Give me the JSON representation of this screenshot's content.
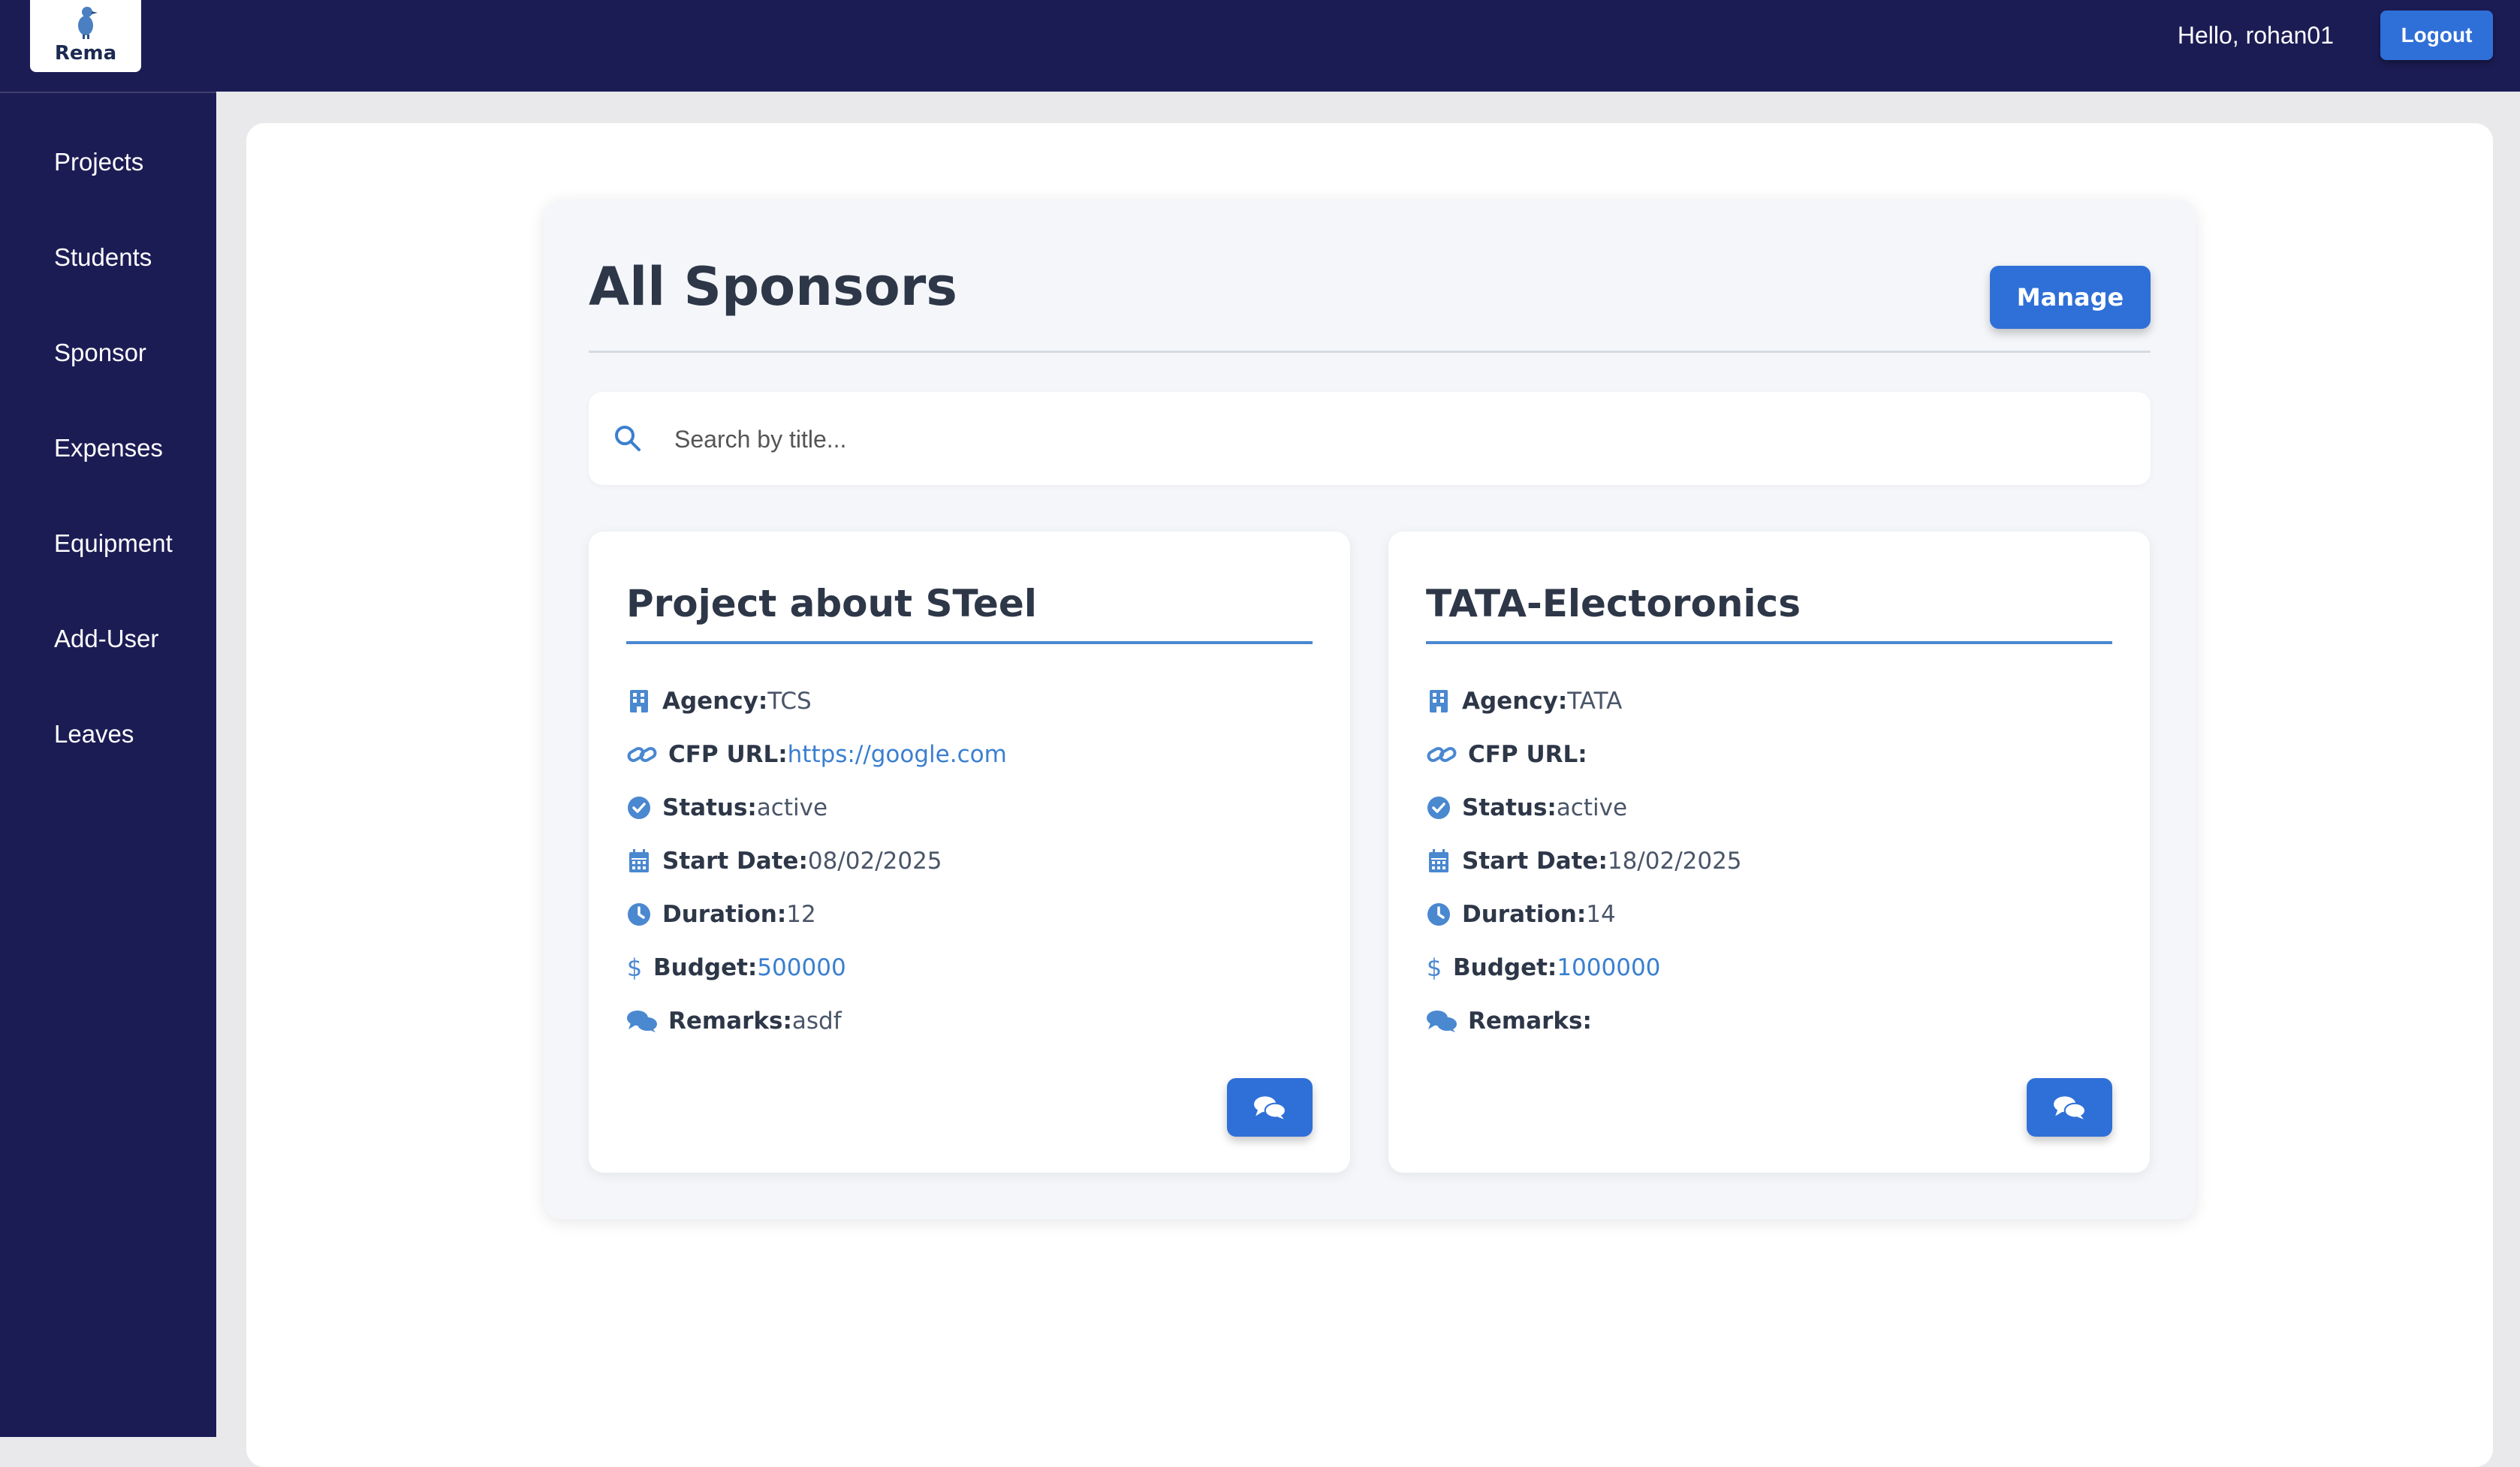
{
  "app": {
    "logo_text": "Rema",
    "greeting": "Hello, rohan01",
    "logout_label": "Logout"
  },
  "sidebar": {
    "items": [
      {
        "label": "Projects"
      },
      {
        "label": "Students"
      },
      {
        "label": "Sponsor"
      },
      {
        "label": "Expenses"
      },
      {
        "label": "Equipment"
      },
      {
        "label": "Add-User"
      },
      {
        "label": "Leaves"
      }
    ]
  },
  "page": {
    "title": "All Sponsors",
    "manage_label": "Manage",
    "search_placeholder": "Search by title..."
  },
  "cards": [
    {
      "title": "Project about STeel",
      "agency_label": "Agency:",
      "agency": "TCS",
      "cfp_label": "CFP URL:",
      "cfp_url": "https://google.com",
      "status_label": "Status:",
      "status": "active",
      "start_label": "Start Date:",
      "start_date": "08/02/2025",
      "duration_label": "Duration:",
      "duration": "12",
      "budget_label": "Budget:",
      "budget": "500000",
      "remarks_label": "Remarks:",
      "remarks": "asdf"
    },
    {
      "title": "TATA-Electoronics",
      "agency_label": "Agency:",
      "agency": "TATA",
      "cfp_label": "CFP URL:",
      "cfp_url": "",
      "status_label": "Status:",
      "status": "active",
      "start_label": "Start Date:",
      "start_date": "18/02/2025",
      "duration_label": "Duration:",
      "duration": "14",
      "budget_label": "Budget:",
      "budget": "1000000",
      "remarks_label": "Remarks:",
      "remarks": ""
    }
  ],
  "icons": {
    "logo": "bird-logo-icon",
    "search": "search-icon",
    "agency": "building-icon",
    "cfp": "link-icon",
    "status": "check-circle-icon",
    "start": "calendar-icon",
    "duration": "clock-icon",
    "budget": "dollar-icon",
    "remarks": "comments-icon",
    "chat": "comments-icon"
  },
  "colors": {
    "navy": "#1c1c55",
    "accent": "#2f6fd8",
    "link": "#3a7fd0",
    "heading": "#2d3748"
  }
}
